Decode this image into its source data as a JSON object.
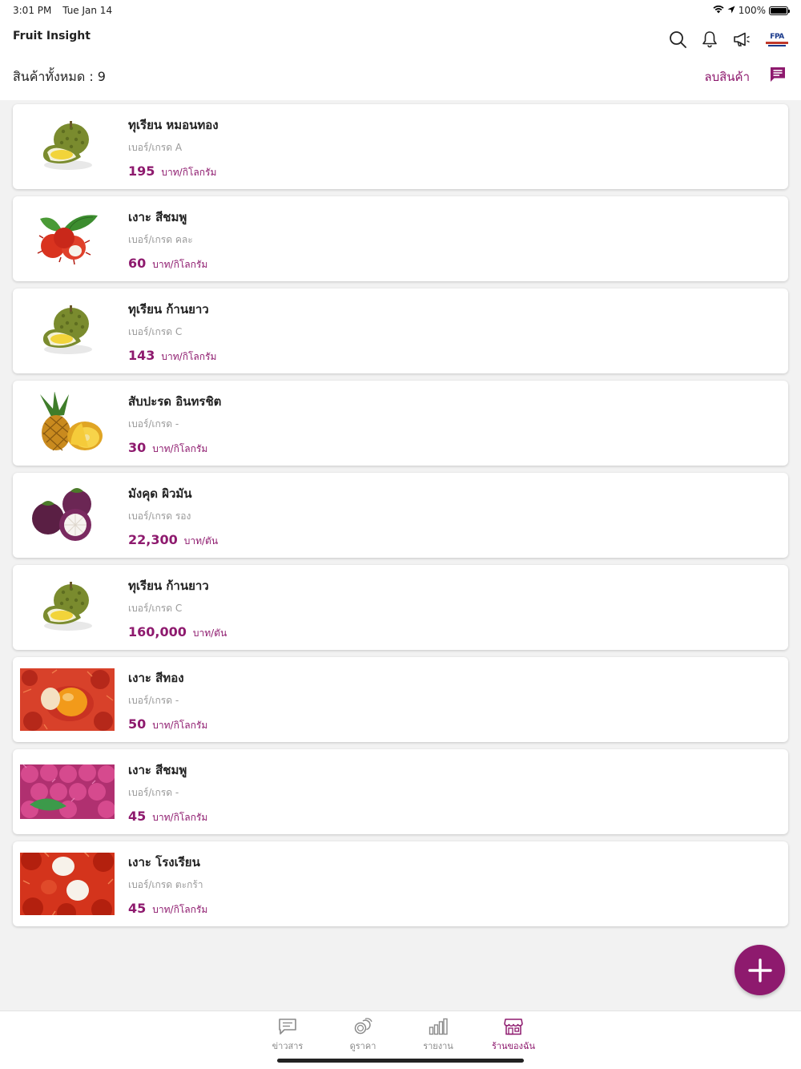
{
  "status_bar": {
    "time": "3:01 PM",
    "date": "Tue Jan 14",
    "battery": "100%"
  },
  "header": {
    "app_title": "Fruit Insight",
    "total_label": "สินค้าทั้งหมด : 9",
    "delete_label": "ลบสินค้า",
    "logo_text": "FPA"
  },
  "products": [
    {
      "name": "ทุเรียน หมอนทอง",
      "grade": "เบอร์/เกรด A",
      "price": "195",
      "unit": "บาท/กิโลกรัม",
      "image": "durian"
    },
    {
      "name": "เงาะ สีชมพู",
      "grade": "เบอร์/เกรด คละ",
      "price": "60",
      "unit": "บาท/กิโลกรัม",
      "image": "rambutan-leaf"
    },
    {
      "name": "ทุเรียน ก้านยาว",
      "grade": "เบอร์/เกรด C",
      "price": "143",
      "unit": "บาท/กิโลกรัม",
      "image": "durian"
    },
    {
      "name": "สับปะรด อินทรชิต",
      "grade": "เบอร์/เกรด -",
      "price": "30",
      "unit": "บาท/กิโลกรัม",
      "image": "pineapple"
    },
    {
      "name": "มังคุด ผิวมัน",
      "grade": "เบอร์/เกรด รอง",
      "price": "22,300",
      "unit": "บาท/ตัน",
      "image": "mangosteen"
    },
    {
      "name": "ทุเรียน ก้านยาว",
      "grade": "เบอร์/เกรด C",
      "price": "160,000",
      "unit": "บาท/ตัน",
      "image": "durian"
    },
    {
      "name": "เงาะ สีทอง",
      "grade": "เบอร์/เกรด -",
      "price": "50",
      "unit": "บาท/กิโลกรัม",
      "image": "rambutan-gold"
    },
    {
      "name": "เงาะ สีชมพู",
      "grade": "เบอร์/เกรด -",
      "price": "45",
      "unit": "บาท/กิโลกรัม",
      "image": "rambutan-pink"
    },
    {
      "name": "เงาะ โรงเรียน",
      "grade": "เบอร์/เกรด ตะกร้า",
      "price": "45",
      "unit": "บาท/กิโลกรัม",
      "image": "rambutan-red"
    }
  ],
  "tabs": [
    {
      "label": "ข่าวสาร",
      "icon": "news-icon",
      "active": false
    },
    {
      "label": "ดูราคา",
      "icon": "coins-icon",
      "active": false
    },
    {
      "label": "รายงาน",
      "icon": "bar-chart-icon",
      "active": false
    },
    {
      "label": "ร้านของฉัน",
      "icon": "store-icon",
      "active": true
    }
  ],
  "colors": {
    "accent": "#8e1a6e",
    "background": "#f2f2f2"
  }
}
